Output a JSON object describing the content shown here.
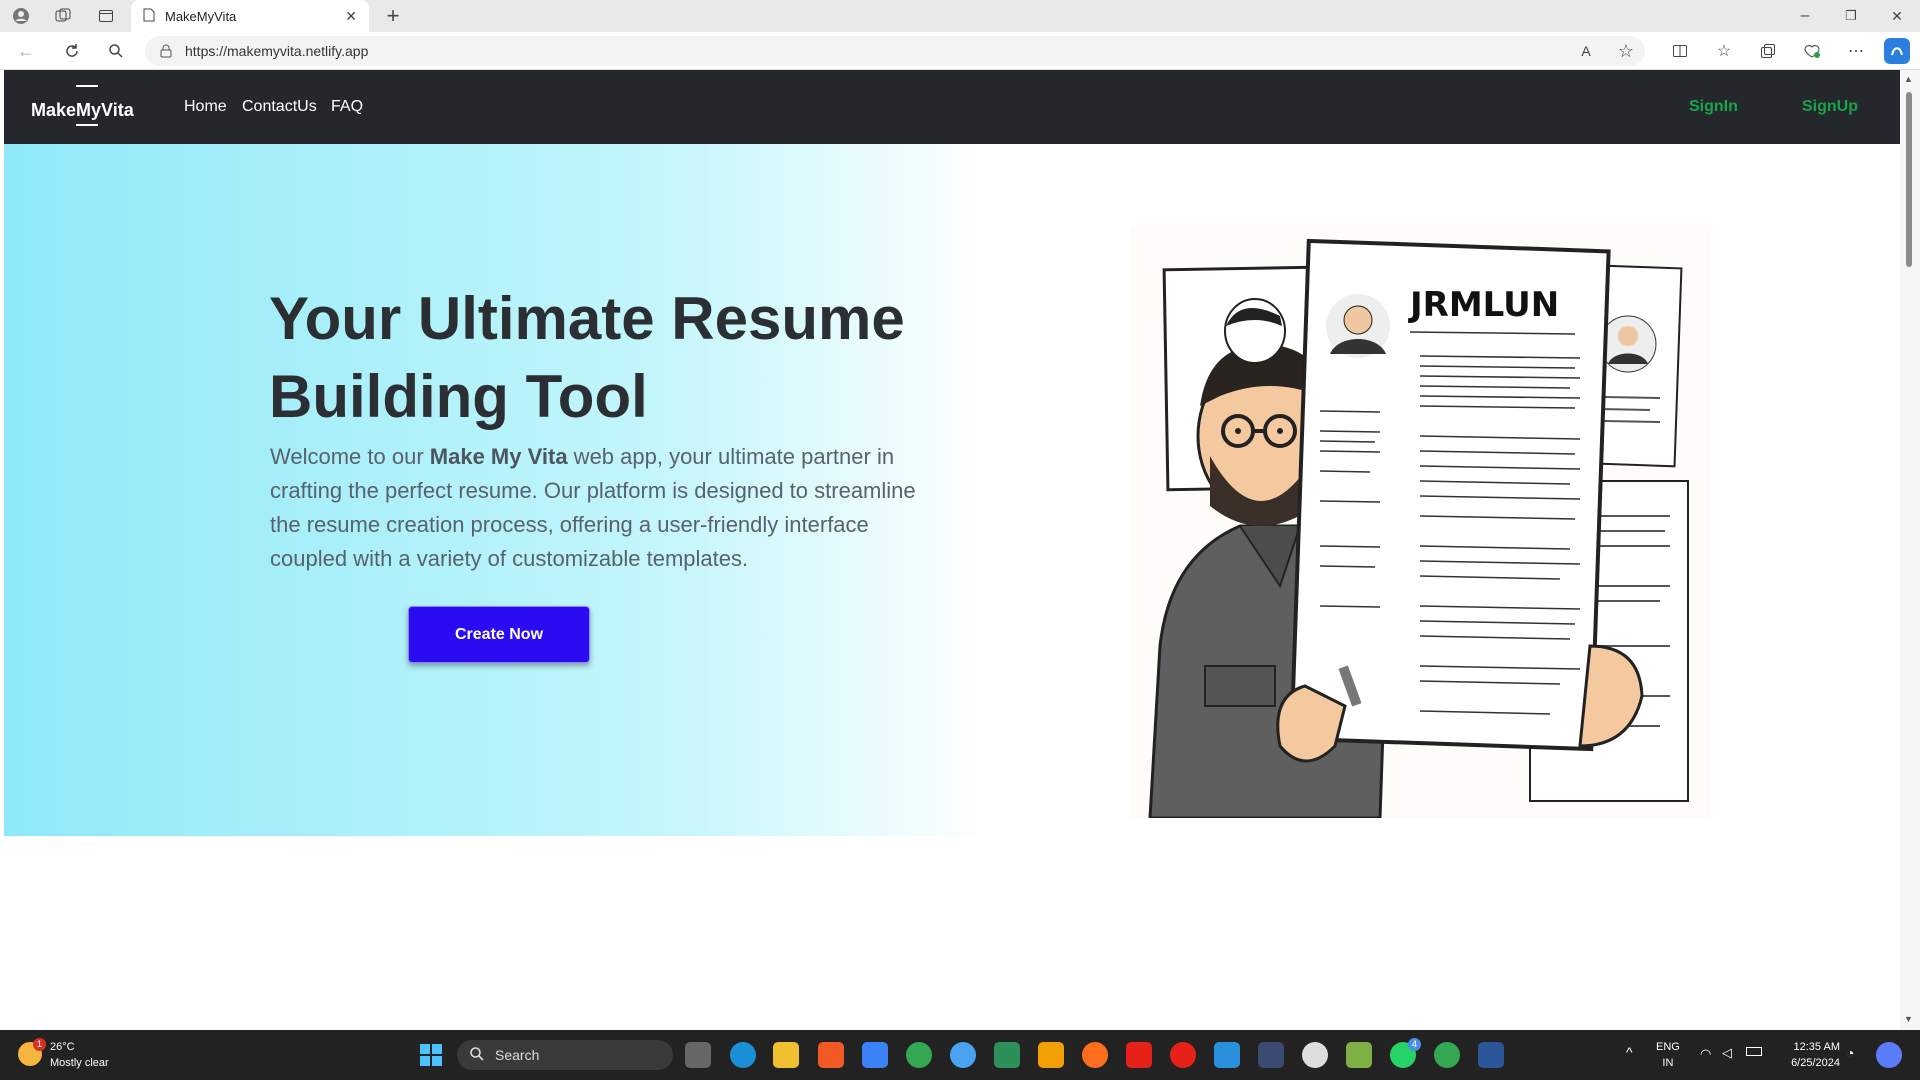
{
  "browser": {
    "tab_title": "MakeMyVita",
    "url": "https://makemyvita.netlify.app",
    "new_tab": "+",
    "window_minimize": "–",
    "window_restore": "❐",
    "window_close": "✕"
  },
  "site": {
    "brand": "MakeMyVita",
    "nav": {
      "home": "Home",
      "contact": "ContactUs",
      "faq": "FAQ",
      "signin": "SignIn",
      "signup": "SignUp"
    },
    "hero": {
      "title_line1": "Your Ultimate Resume",
      "title_line2": "Building Tool",
      "text_before": "Welcome to our ",
      "text_bold": "Make My Vita",
      "text_after": " web app, your ultimate partner in crafting the perfect resume. Our platform is designed to streamline the resume creation process, offering a user-friendly interface coupled with a variety of customizable templates.",
      "button": "Create Now",
      "illustration_heading": "JRMLUN"
    }
  },
  "taskbar": {
    "weather_temp": "26°C",
    "weather_desc": "Mostly clear",
    "weather_badge": "1",
    "search_placeholder": "Search",
    "lang_line1": "ENG",
    "lang_line2": "IN",
    "time": "12:35 AM",
    "date": "6/25/2024",
    "whatsapp_badge": "4"
  },
  "colors": {
    "navbar_bg": "#24282d",
    "auth_link": "#1aa34a",
    "hero_gradient_start": "#8fe9f8",
    "button_bg": "#2b0cf2"
  }
}
